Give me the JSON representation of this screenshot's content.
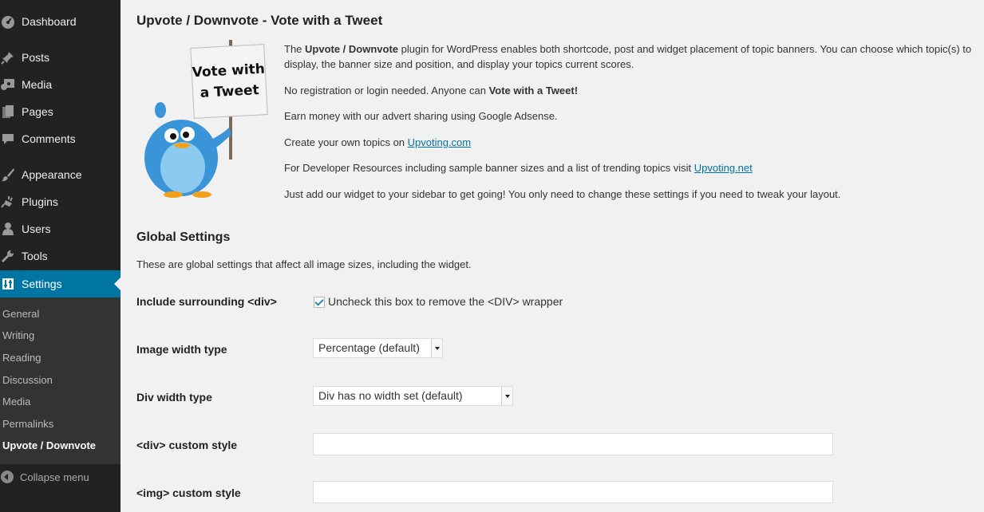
{
  "sidebar": {
    "items": [
      {
        "label": "Dashboard",
        "icon": "dashboard-icon"
      },
      {
        "label": "Posts",
        "icon": "pin-icon"
      },
      {
        "label": "Media",
        "icon": "media-icon"
      },
      {
        "label": "Pages",
        "icon": "pages-icon"
      },
      {
        "label": "Comments",
        "icon": "comment-icon"
      },
      {
        "label": "Appearance",
        "icon": "brush-icon"
      },
      {
        "label": "Plugins",
        "icon": "plugin-icon"
      },
      {
        "label": "Users",
        "icon": "user-icon"
      },
      {
        "label": "Tools",
        "icon": "wrench-icon"
      },
      {
        "label": "Settings",
        "icon": "settings-icon"
      }
    ],
    "submenu": [
      "General",
      "Writing",
      "Reading",
      "Discussion",
      "Media",
      "Permalinks",
      "Upvote / Downvote"
    ],
    "collapse_label": "Collapse menu"
  },
  "page": {
    "title": "Upvote / Downvote - Vote with a Tweet",
    "sign_text": [
      "Vote with",
      "a Tweet"
    ],
    "intro": {
      "p1_before": "The ",
      "p1_bold": "Upvote / Downvote",
      "p1_after": " plugin for WordPress enables both shortcode, post and widget placement of topic banners. You can choose which topic(s) to display, the banner size and position, and display your topics current scores.",
      "p2_before": "No registration or login needed. Anyone can ",
      "p2_bold": "Vote with a Tweet!",
      "p3": "Earn money with our advert sharing using Google Adsense.",
      "p4_before": "Create your own topics on ",
      "p4_link": "Upvoting.com",
      "p5_before": "For Developer Resources including sample banner sizes and a list of trending topics visit ",
      "p5_link": "Upvoting.net",
      "p6": "Just add our widget to your sidebar to get going! You only need to change these settings if you need to tweak your layout."
    },
    "global_settings": {
      "title": "Global Settings",
      "description": "These are global settings that affect all image sizes, including the widget.",
      "include_div_label": "Include surrounding <div>",
      "include_div_checked": true,
      "include_div_hint": "Uncheck this box to remove the <DIV> wrapper",
      "image_width_type_label": "Image width type",
      "image_width_type_value": "Percentage (default)",
      "div_width_type_label": "Div width type",
      "div_width_type_value": "Div has no width set (default)",
      "div_style_label": "<div> custom style",
      "div_style_value": "",
      "img_style_label": "<img> custom style",
      "img_style_value": ""
    }
  }
}
